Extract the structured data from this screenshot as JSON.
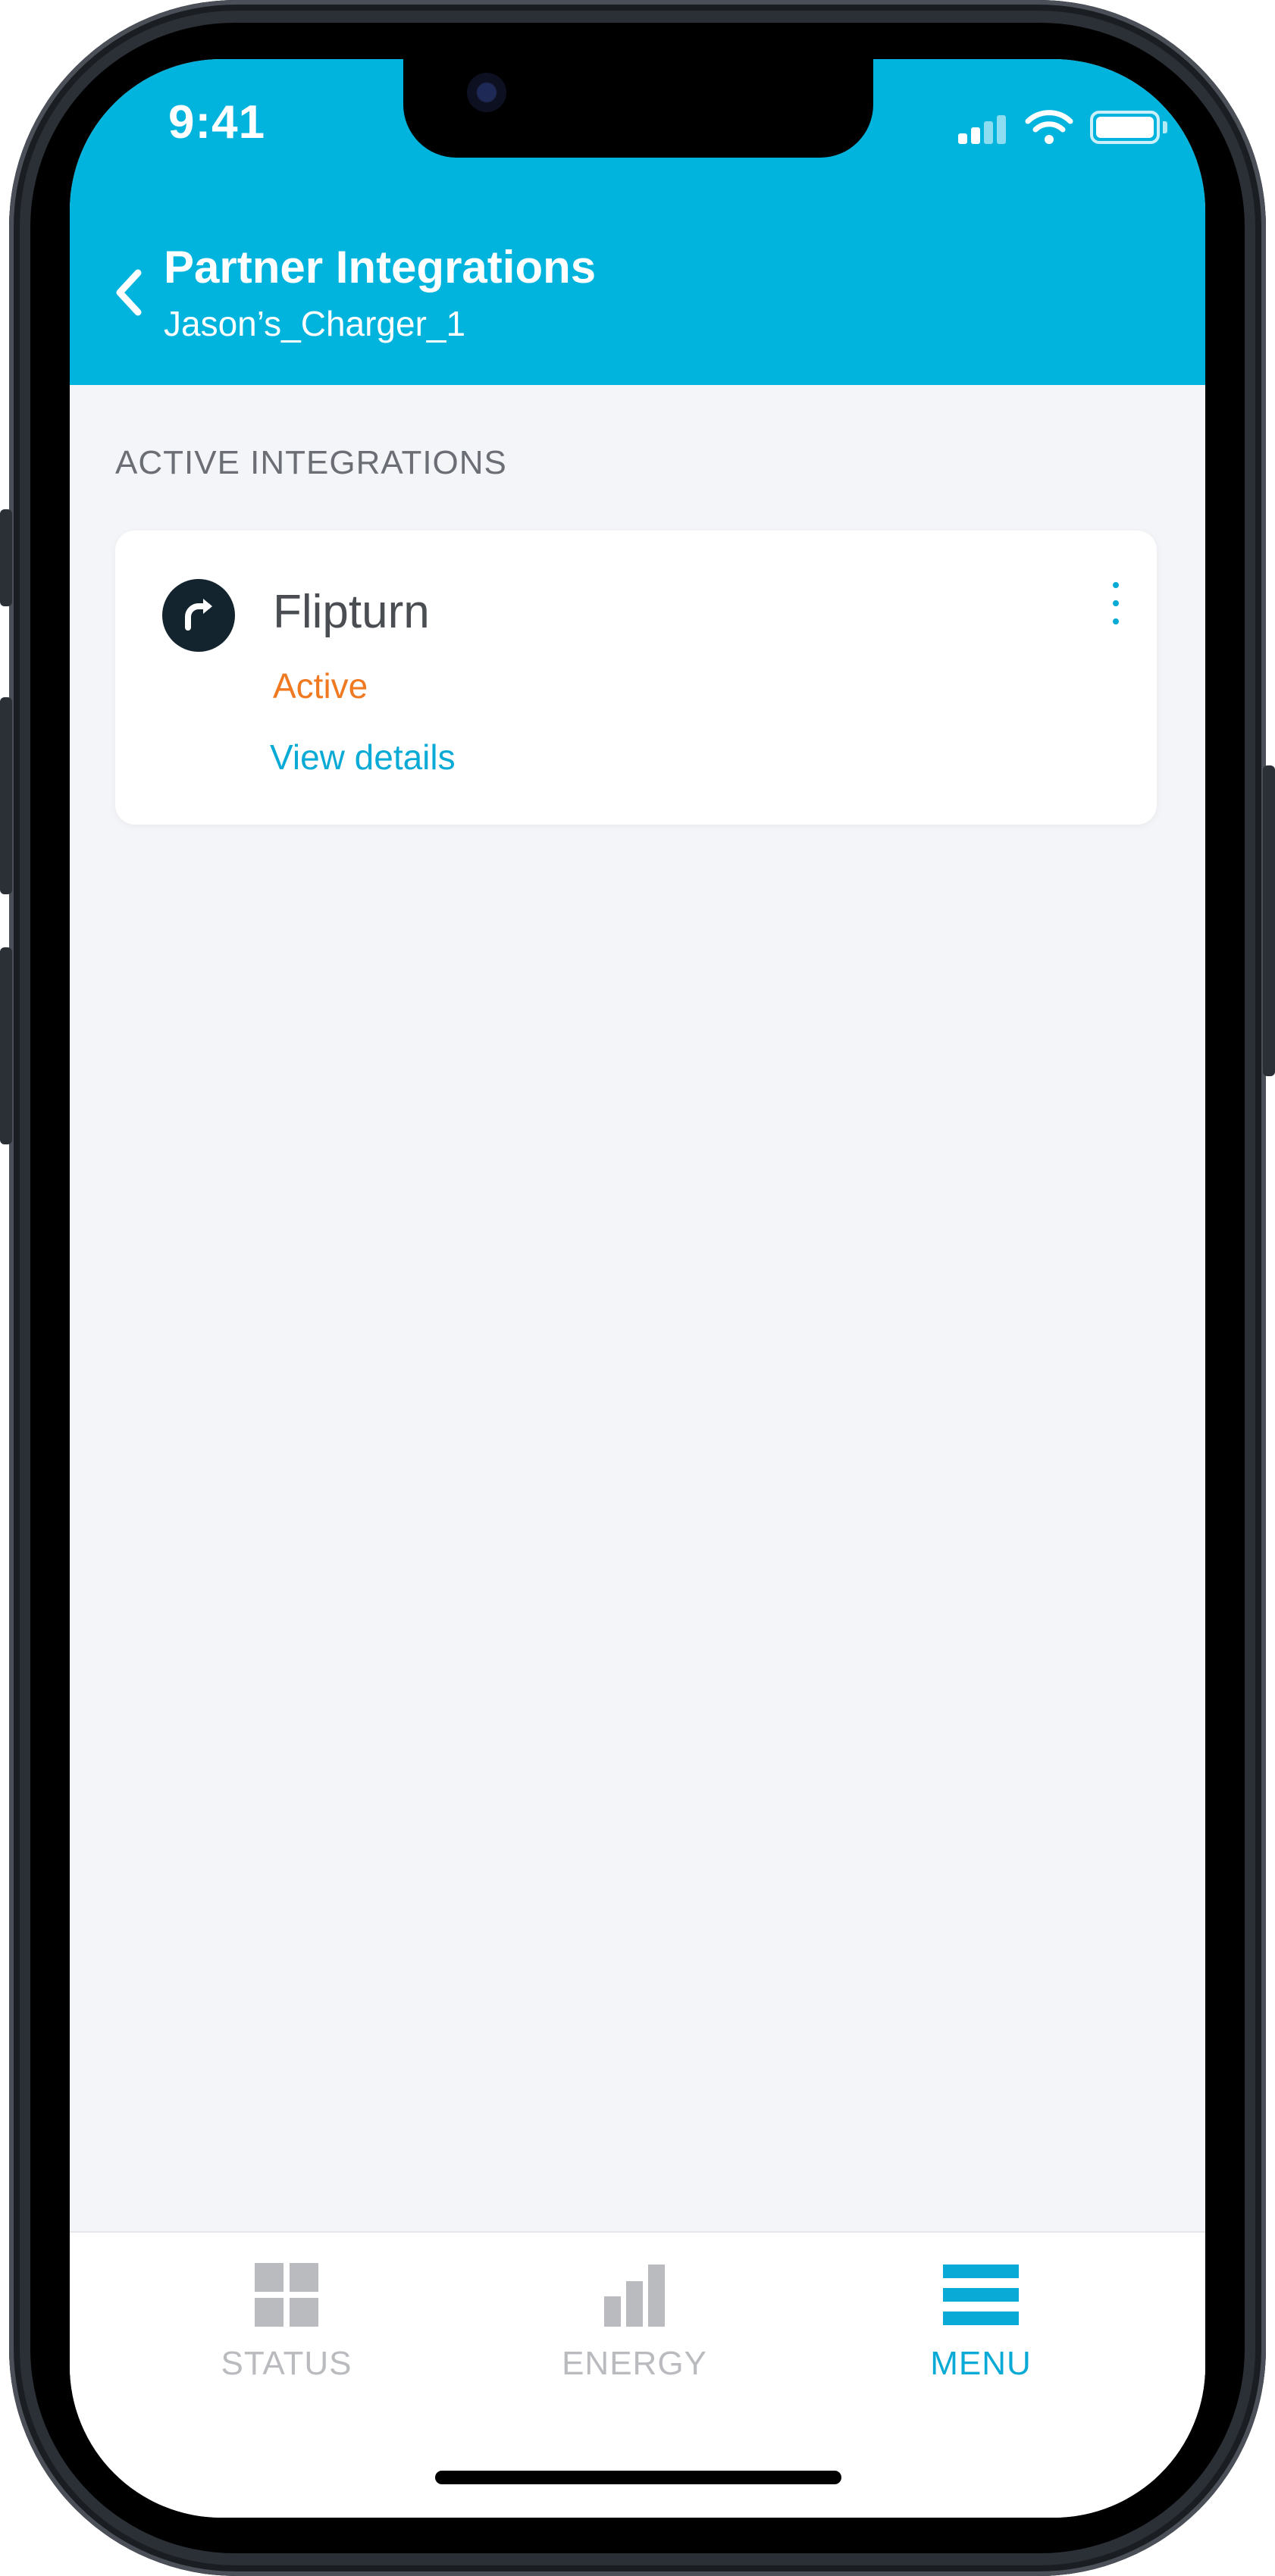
{
  "status_bar": {
    "time": "9:41"
  },
  "header": {
    "title": "Partner Integrations",
    "subtitle": "Jason’s_Charger_1",
    "back_icon": "chevron-left-icon"
  },
  "section": {
    "label": "ACTIVE INTEGRATIONS"
  },
  "integrations": [
    {
      "name": "Flipturn",
      "status": "Active",
      "link": "View details",
      "logo_icon": "flipturn-logo-icon",
      "menu_icon": "more-vertical-icon"
    }
  ],
  "tabbar": {
    "tabs": [
      {
        "label": "STATUS",
        "icon": "grid-icon",
        "active": false
      },
      {
        "label": "ENERGY",
        "icon": "bar-chart-icon",
        "active": false
      },
      {
        "label": "MENU",
        "icon": "hamburger-menu-icon",
        "active": true
      }
    ]
  },
  "colors": {
    "header_bg": "#00b4de",
    "status_active": "#f07a22",
    "link": "#0aaad6",
    "tab_inactive": "#b9bbbf",
    "tab_active": "#0aaad6"
  }
}
